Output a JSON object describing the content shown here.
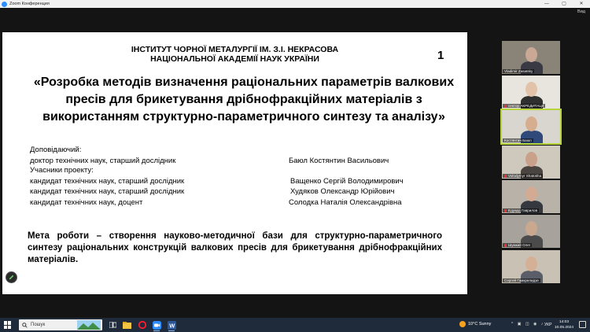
{
  "window": {
    "title": "Zoom Конференция",
    "minimize": "—",
    "maximize": "▢",
    "close": "✕",
    "view_label": "Вид"
  },
  "slide": {
    "institute_line1": "ІНСТИТУТ ЧОРНОЇ МЕТАЛУРГІЇ ІМ. З.І. НЕКРАСОВА",
    "institute_line2": "НАЦІОНАЛЬНОЇ АКАДЕМІЇ НАУК УКРАЇНИ",
    "page_number": "1",
    "title": "«Розробка методів визначення раціональних параметрів валкових пресів для брикетування дрібнофракційних матеріалів з використанням структурно-параметричного синтезу та аналізу»",
    "speaker_label": "Доповідаючий:",
    "speaker_degree": "доктор технічних наук, старший дослідник",
    "speaker_name": "Баюл Костянтин Васильович",
    "participants_label": "Учасники проекту:",
    "participants": [
      {
        "degree": "кандидат технічних наук, старший дослідник",
        "name": "Ващенко Сергій Володимирович"
      },
      {
        "degree": "кандидат технічних наук, старший дослідник",
        "name": "Худяков Олександр Юрійович"
      },
      {
        "degree": "кандидат технічних наук, доцент",
        "name": "Солодка Наталія Олександрівна"
      }
    ],
    "goal": "Мета роботи – створення науково-методичної бази для структурно-параметричного синтезу раціональних конструкцій валкових пресів для брикетування дрібнофракційних матеріалів."
  },
  "gallery": [
    {
      "name": "Vladimir Zasatsky",
      "muted": false,
      "bg": "#8a8478",
      "face": "#c9a896",
      "shirt": "#3a3a44"
    },
    {
      "name": "сектор АКРЕДИТАЦІЇ",
      "muted": true,
      "bg": "#e8e4de",
      "face": "#e2c2a8",
      "shirt": "#2f2f2f"
    },
    {
      "name": "Костянтин Баюл",
      "muted": false,
      "bg": "#d9d6cf",
      "face": "#d6ad8f",
      "shirt": "#2f4a7a"
    },
    {
      "name": "Volodymyr Shatokha",
      "muted": true,
      "bg": "#cfc8bd",
      "face": "#c9a08a",
      "shirt": "#4a4440"
    },
    {
      "name": "Едуард Гаврилов",
      "muted": true,
      "bg": "#b8b2a8",
      "face": "#d2ab92",
      "shirt": "#36383f"
    },
    {
      "name": "Шумкий Олег",
      "muted": true,
      "bg": "#a7a39c",
      "face": "#caa890",
      "shirt": "#4b4b4b"
    },
    {
      "name": "Сергей Гамкрелидзе",
      "muted": false,
      "bg": "#c9c2b4",
      "face": "#d4b096",
      "shirt": "#5a5e68"
    }
  ],
  "taskbar": {
    "search_placeholder": "Пошук",
    "weather": "10°C  Sunny",
    "language": "УКР",
    "time": "14:03",
    "date": "10.05.2024"
  },
  "colors": {
    "zoom_blue": "#2d8cff",
    "active_speaker": "#b7d43a",
    "taskbar": "#1f2b3a"
  }
}
